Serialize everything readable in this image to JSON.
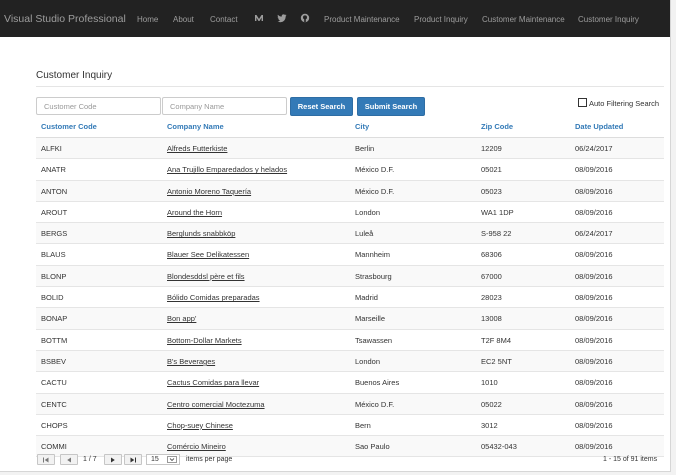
{
  "navbar": {
    "brand": "Visual Studio Professional",
    "links": [
      "Home",
      "About",
      "Contact"
    ],
    "icons": [
      "medium-icon",
      "twitter-icon",
      "github-icon"
    ],
    "menu": [
      "Product Maintenance",
      "Product Inquiry",
      "Customer Maintenance",
      "Customer Inquiry"
    ]
  },
  "page": {
    "title": "Customer Inquiry"
  },
  "search": {
    "customer_code_placeholder": "Customer Code",
    "company_name_placeholder": "Company Name",
    "customer_code_value": "",
    "company_name_value": "",
    "reset_label": "Reset Search",
    "submit_label": "Submit Search",
    "auto_filter_label": "Auto Filtering Search",
    "auto_filter_checked": false
  },
  "table": {
    "columns": [
      "Customer Code",
      "Company Name",
      "City",
      "Zip Code",
      "Date Updated"
    ],
    "rows": [
      [
        "ALFKI",
        "Alfreds Futterkiste",
        "Berlin",
        "12209",
        "06/24/2017"
      ],
      [
        "ANATR",
        "Ana Trujillo Emparedados y helados",
        "México D.F.",
        "05021",
        "08/09/2016"
      ],
      [
        "ANTON",
        "Antonio Moreno Taquería",
        "México D.F.",
        "05023",
        "08/09/2016"
      ],
      [
        "AROUT",
        "Around the Horn",
        "London",
        "WA1 1DP",
        "08/09/2016"
      ],
      [
        "BERGS",
        "Berglunds snabbköp",
        "Luleå",
        "S-958 22",
        "06/24/2017"
      ],
      [
        "BLAUS",
        "Blauer See Delikatessen",
        "Mannheim",
        "68306",
        "08/09/2016"
      ],
      [
        "BLONP",
        "Blondesddsl père et fils",
        "Strasbourg",
        "67000",
        "08/09/2016"
      ],
      [
        "BOLID",
        "Bólido Comidas preparadas",
        "Madrid",
        "28023",
        "08/09/2016"
      ],
      [
        "BONAP",
        "Bon app'",
        "Marseille",
        "13008",
        "08/09/2016"
      ],
      [
        "BOTTM",
        "Bottom-Dollar Markets",
        "Tsawassen",
        "T2F 8M4",
        "08/09/2016"
      ],
      [
        "BSBEV",
        "B's Beverages",
        "London",
        "EC2 5NT",
        "08/09/2016"
      ],
      [
        "CACTU",
        "Cactus Comidas para llevar",
        "Buenos Aires",
        "1010",
        "08/09/2016"
      ],
      [
        "CENTC",
        "Centro comercial Moctezuma",
        "México D.F.",
        "05022",
        "08/09/2016"
      ],
      [
        "CHOPS",
        "Chop-suey Chinese",
        "Bern",
        "3012",
        "08/09/2016"
      ],
      [
        "COMMI",
        "Comércio Mineiro",
        "Sao Paulo",
        "05432-043",
        "08/09/2016"
      ]
    ]
  },
  "pager": {
    "page_display": "1 / 7",
    "page_size": "15",
    "page_size_label": "items per page",
    "summary": "1 - 15 of 91 items"
  },
  "colors": {
    "navbar": "#222222",
    "accent": "#337ab7",
    "nav_text": "#9d9d9d"
  }
}
